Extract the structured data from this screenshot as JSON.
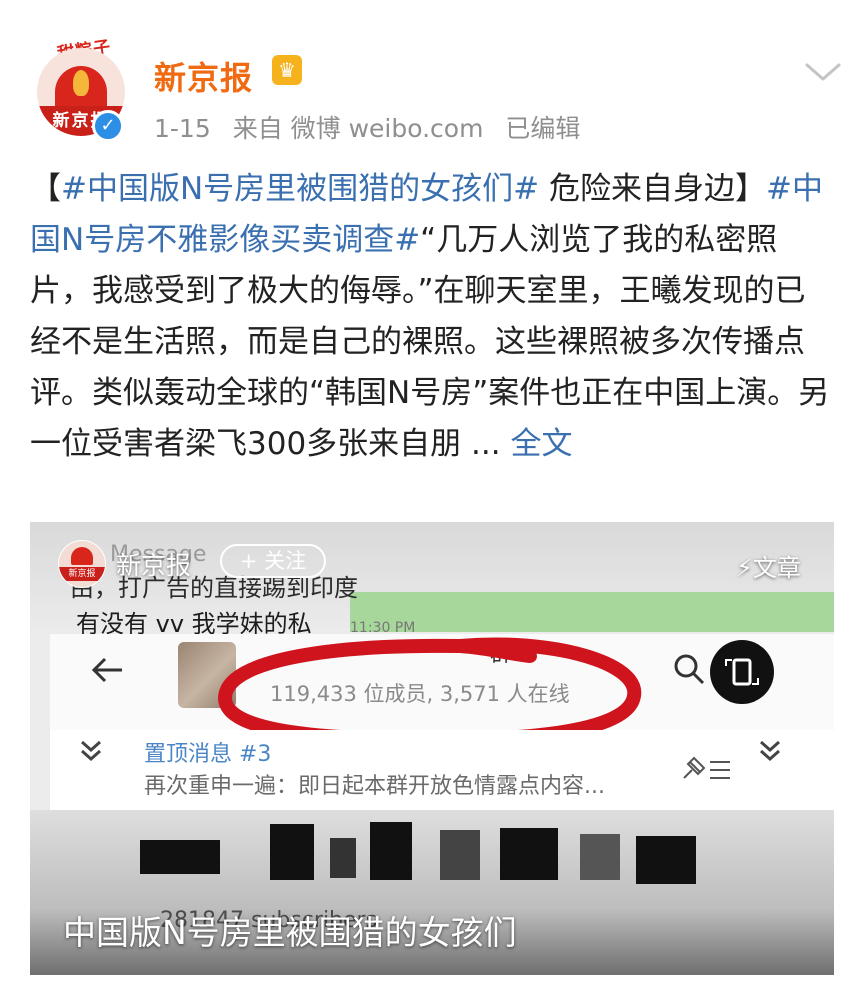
{
  "author": {
    "name": "新京报",
    "avatar_banner": "甜粽子",
    "avatar_text": "新京报",
    "verified_icon": "verified-check-icon",
    "member_icon": "vip-crown-icon"
  },
  "meta": {
    "date": "1-15",
    "source": "来自 微博 weibo.com",
    "edited": "已编辑"
  },
  "post": {
    "bracket_open": "【",
    "topic1": "#中国版N号房里被围猎的女孩们#",
    "text1": " 危险来自身边】",
    "topic2": "#中国N号房不雅影像买卖调查#",
    "text2": "“几万人浏览了我的私密照片，我感受到了极大的侮辱。”在聊天室里，王曦发现的已经不是生活照，而是自己的裸照。这些裸照被多次传播点评。类似轰动全球的“韩国N号房”案件也正在中国上演。另一位受害者梁飞300多张来自朋 ... ",
    "fulltext_link": "全文"
  },
  "video": {
    "source_name": "新京报",
    "source_avatar_text": "新京报",
    "follow_label": "+ 关注",
    "article_label": "文章",
    "caption": "中国版N号房里被围猎的女孩们",
    "screen": {
      "msg_title": "Message",
      "msg1": "由，打广告的直接踢到印度",
      "msg2": "有没有 vv 我学妹的私",
      "msg_time": "11:30 PM",
      "group_name": "群",
      "members": "119,433 位成员, 3,571 人在线",
      "pinned_title": "置顶消息 #3",
      "pinned_text": "再次重申一遍：即日起本群开放色情露点内容...",
      "subscribers": "281847 subscribers"
    }
  },
  "colors": {
    "author_orange": "#f06a12",
    "topic_blue": "#3a6fb0",
    "meta_gray": "#8f8f8f",
    "verified_blue": "#2d8ee6",
    "highlight_red": "#d0141e"
  }
}
